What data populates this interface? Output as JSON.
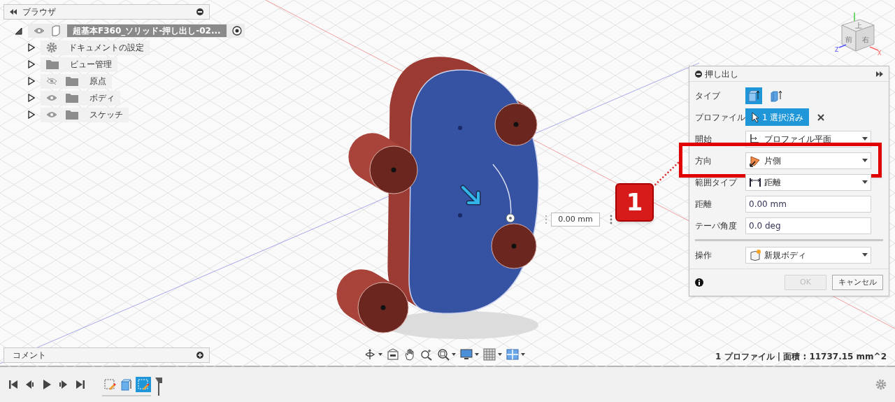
{
  "browser": {
    "title": "ブラウザ",
    "root": {
      "label": "超基本F360_ソリッド-押し出し-02...",
      "visible": true,
      "expanded": true,
      "children": [
        {
          "label": "ドキュメントの設定",
          "kind": "settings",
          "expanded": false
        },
        {
          "label": "ビュー管理",
          "kind": "folder",
          "expanded": false
        },
        {
          "label": "原点",
          "kind": "folder",
          "expanded": false,
          "visible": false
        },
        {
          "label": "ボディ",
          "kind": "folder",
          "expanded": false,
          "visible": true
        },
        {
          "label": "スケッチ",
          "kind": "folder",
          "expanded": false,
          "visible": true
        }
      ]
    }
  },
  "comments": {
    "title": "コメント"
  },
  "view_cube": {
    "faces": [
      "上",
      "前",
      "右"
    ],
    "axes": [
      "Z",
      "X"
    ]
  },
  "canvas": {
    "dimension_value": "0.00 mm"
  },
  "callout": {
    "label": "1"
  },
  "dialog": {
    "title": "押し出し",
    "rows": [
      {
        "kind": "type",
        "label": "タイプ",
        "options": [
          {
            "selected": true
          },
          {
            "selected": false
          }
        ]
      },
      {
        "kind": "selection",
        "label": "プロファイル",
        "value": "1 選択済み"
      },
      {
        "kind": "dropdown",
        "label": "開始",
        "value": "プロファイル平面",
        "highlighted": false
      },
      {
        "kind": "dropdown",
        "label": "方向",
        "value": "片側",
        "highlighted": true
      },
      {
        "kind": "dropdown",
        "label": "範囲タイプ",
        "value": "距離",
        "highlighted": false
      },
      {
        "kind": "input",
        "label": "距離",
        "value": "0.00 mm"
      },
      {
        "kind": "input",
        "label": "テーパ角度",
        "value": "0.0 deg"
      }
    ],
    "operation": {
      "label": "操作",
      "value": "新規ボディ"
    },
    "buttons": [
      {
        "label": "OK",
        "disabled": true
      },
      {
        "label": "キャンセル",
        "disabled": false
      }
    ]
  },
  "status": "1 プロファイル | 面積 : 11737.15 mm^2",
  "timeline": {
    "features": [
      {
        "kind": "sketch",
        "selected": false
      },
      {
        "kind": "extrude",
        "selected": false
      },
      {
        "kind": "sketch",
        "selected": true
      }
    ]
  }
}
